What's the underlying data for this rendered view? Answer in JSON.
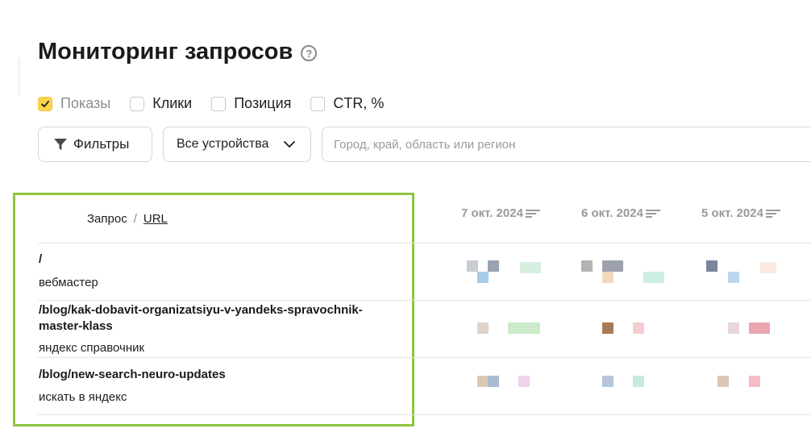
{
  "page": {
    "title": "Мониторинг запросов",
    "help_icon": "question-circle-icon"
  },
  "metrics": [
    {
      "label": "Показы",
      "checked": true
    },
    {
      "label": "Клики",
      "checked": false
    },
    {
      "label": "Позиция",
      "checked": false
    },
    {
      "label": "CTR, %",
      "checked": false
    }
  ],
  "controls": {
    "filters_label": "Фильтры",
    "devices_label": "Все устройства",
    "region_placeholder": "Город, край, область или регион"
  },
  "table": {
    "header": {
      "query": "Запрос",
      "separator": "/",
      "url": "URL"
    },
    "dates": [
      "7 окт. 2024",
      "6 окт. 2024",
      "5 окт. 2024"
    ],
    "rows": [
      {
        "url": "/",
        "query": "вебмастер"
      },
      {
        "url": "/blog/kak-dobavit-organizatsiyu-v-yandeks-spravochnik-master-klass",
        "query": "яндекс справочник"
      },
      {
        "url": "/blog/new-search-neuro-updates",
        "query": "искать в яндекс"
      }
    ]
  },
  "colors": {
    "highlight_frame": "#8cc63f",
    "checkbox_checked": "#fcd34d"
  }
}
